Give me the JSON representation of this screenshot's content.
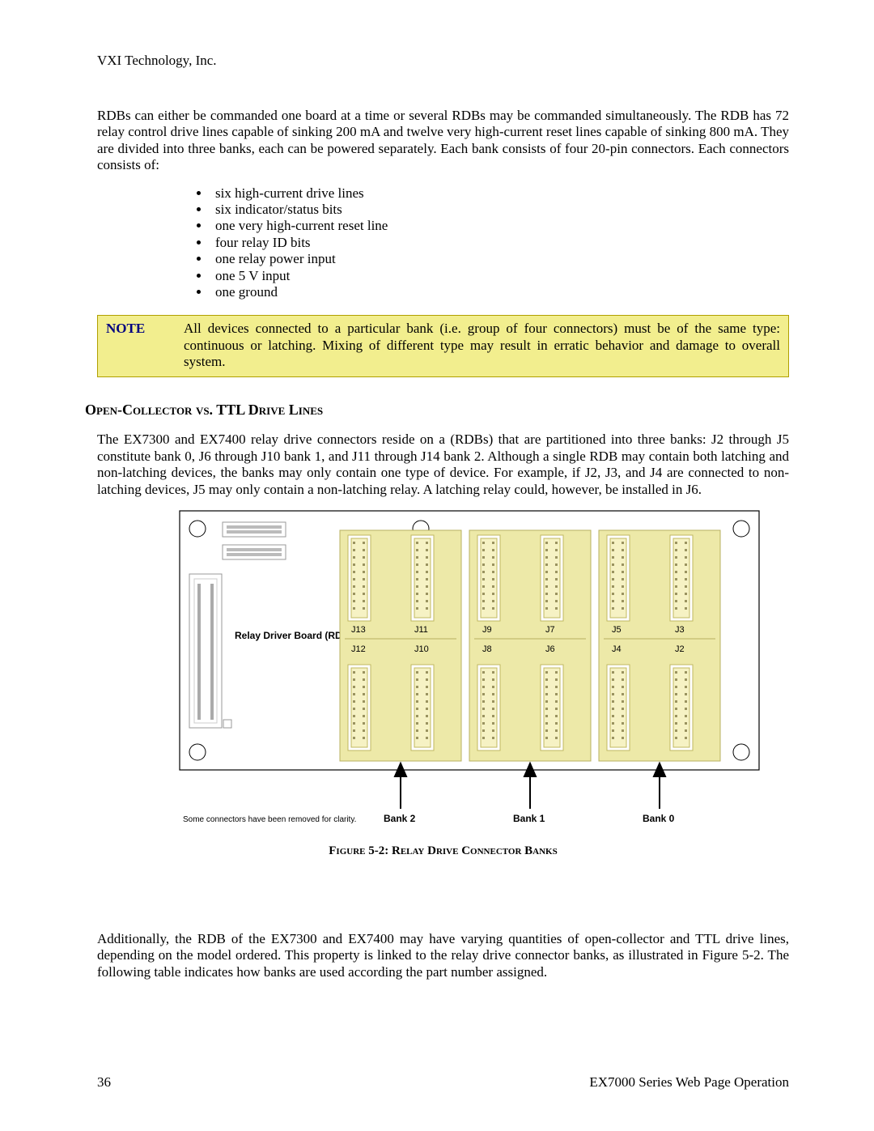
{
  "header": {
    "company": "VXI Technology, Inc."
  },
  "intro_para": "RDBs can either be commanded one board at a time or several RDBs may be commanded simultaneously. The RDB has 72 relay control drive lines capable of sinking 200 mA and twelve very high-current reset lines capable of sinking 800 mA. They are divided into three banks, each can be powered separately. Each bank consists of four 20-pin connectors. Each connectors consists of:",
  "connector_items": [
    "six high-current drive lines",
    "six indicator/status bits",
    "one very high-current reset line",
    "four relay ID bits",
    "one relay power input",
    "one 5 V input",
    "one ground"
  ],
  "note": {
    "label": "NOTE",
    "text": "All devices connected to a particular bank (i.e. group of four connectors) must be of the same type: continuous or latching. Mixing of different type may result in erratic behavior and damage to overall system."
  },
  "section_heading": "Open-Collector vs. TTL Drive Lines",
  "section_para": "The EX7300 and EX7400 relay drive connectors reside on a  (RDBs) that are partitioned into three banks: J2 through J5 constitute bank 0, J6 through J10 bank 1, and J11 through J14 bank 2. Although a single RDB may contain both latching and non-latching devices, the banks may only contain one type of device. For example, if J2, J3, and J4 are connected to non-latching devices, J5 may only contain a non-latching relay. A latching relay could, however, be installed in J6.",
  "diagram": {
    "board_label": "Relay Driver Board (RDB)",
    "footnote": "Some connectors have been removed for clarity.",
    "top_row": [
      "J13",
      "J11",
      "J9",
      "J7",
      "J5",
      "J3"
    ],
    "bottom_row": [
      "J12",
      "J10",
      "J8",
      "J6",
      "J4",
      "J2"
    ],
    "banks": [
      "Bank 2",
      "Bank 1",
      "Bank 0"
    ]
  },
  "figure_caption": "Figure 5-2: Relay Drive Connector Banks",
  "closing_para": "Additionally, the RDB of the EX7300 and EX7400 may have varying quantities of open-collector and TTL drive lines, depending on the model ordered. This property is linked to the relay drive connector banks, as illustrated in Figure 5-2. The following table indicates how banks are used according the part number assigned.",
  "footer": {
    "page_number": "36",
    "doc_title": "EX7000 Series Web Page Operation"
  }
}
